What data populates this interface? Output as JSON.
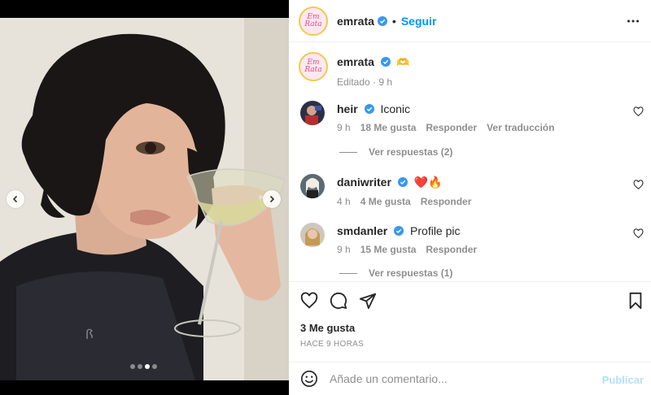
{
  "post": {
    "account": {
      "username": "emrata",
      "avatar_text_line1": "Em",
      "avatar_text_line2": "Rata",
      "follow_label": "Seguir",
      "separator": "•"
    },
    "caption": {
      "username": "emrata",
      "emoji": "🫶",
      "edited_label": "Editado",
      "dot": "·",
      "time": "9 h"
    },
    "comments": [
      {
        "username": "heir",
        "text": "Iconic",
        "time": "9 h",
        "likes": "18 Me gusta",
        "reply_label": "Responder",
        "translate_label": "Ver traducción",
        "view_replies": "Ver respuestas (2)"
      },
      {
        "username": "daniwriter",
        "text": "❤️🔥",
        "time": "4 h",
        "likes": "4 Me gusta",
        "reply_label": "Responder"
      },
      {
        "username": "smdanler",
        "text": "Profile pic",
        "time": "9 h",
        "likes": "15 Me gusta",
        "reply_label": "Responder",
        "view_replies": "Ver respuestas (1)"
      }
    ],
    "likes_total": "3 Me gusta",
    "posted_ago": "HACE 9 HORAS",
    "composer": {
      "placeholder": "Añade un comentario...",
      "post_label": "Publicar"
    },
    "carousel": {
      "slides": 4,
      "active_index": 2
    },
    "colors": {
      "accent_blue": "#0095f6",
      "muted": "#8e8e8e",
      "publish_disabled": "#b2dffc",
      "verified_blue": "#3897f0"
    },
    "icons": [
      "chevron-left-icon",
      "chevron-right-icon",
      "more-icon",
      "verified-icon",
      "heart-icon",
      "comment-icon",
      "share-icon",
      "bookmark-icon",
      "emoji-icon"
    ]
  }
}
